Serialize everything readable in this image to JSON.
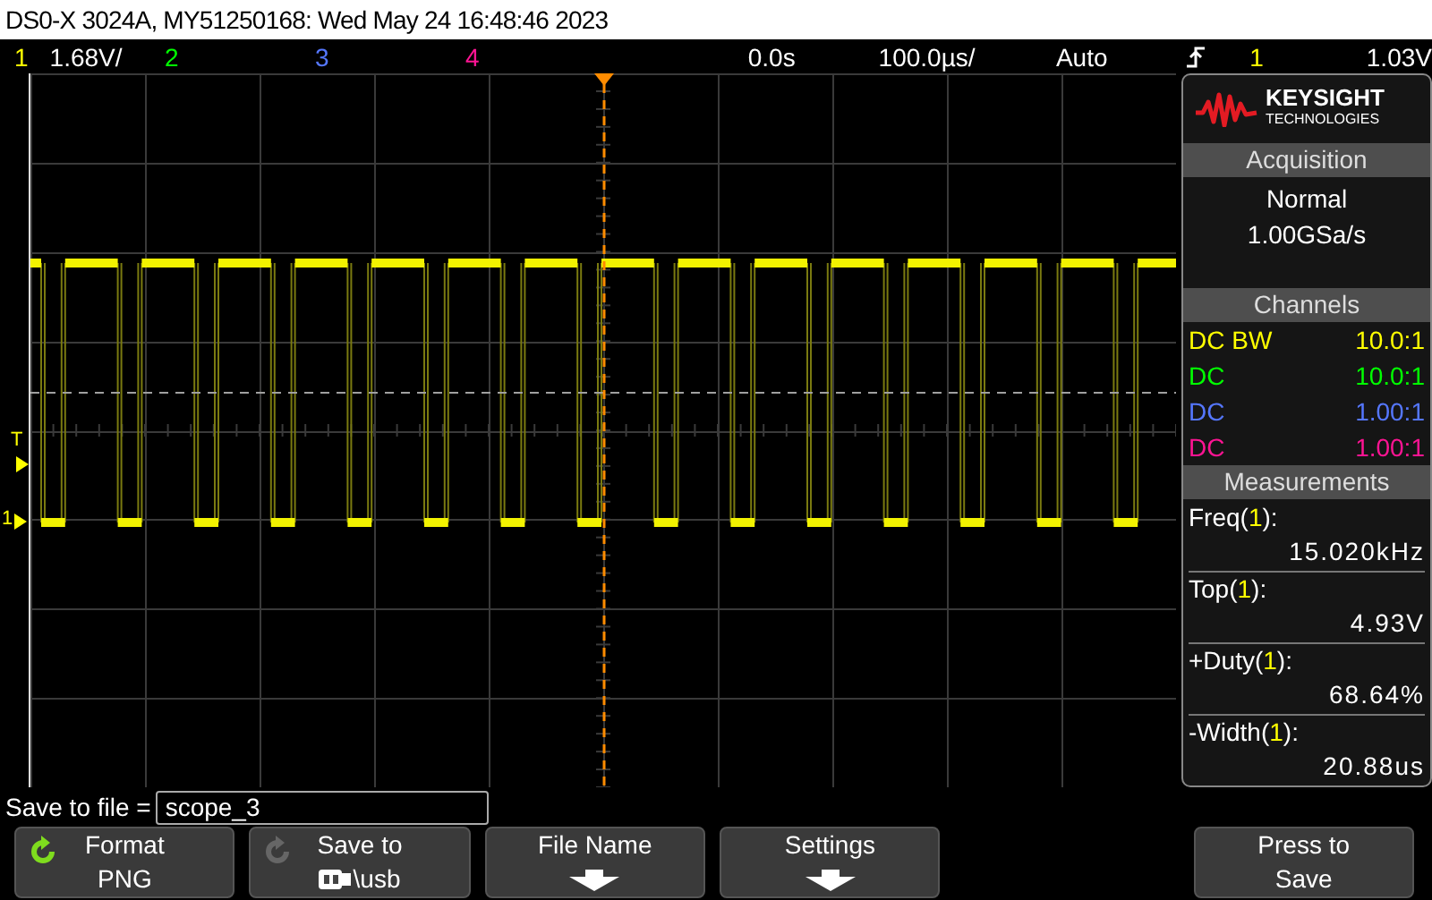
{
  "title_bar": {
    "text": "DS0-X 3024A, MY51250168: Wed May 24 16:48:46 2023"
  },
  "status_bar": {
    "channels": [
      {
        "label": "1",
        "scale": "1.68V/",
        "color": "#ffff00"
      },
      {
        "label": "2",
        "color": "#00ff00"
      },
      {
        "label": "3",
        "color": "#5577ff"
      },
      {
        "label": "4",
        "color": "#ff1493"
      }
    ],
    "delay": "0.0s",
    "timebase": "100.0µs/",
    "mode": "Auto",
    "trigger_source": "1",
    "trigger_level": "1.03V"
  },
  "graticule": {
    "trigger_marker": "T",
    "ground_marker": "1"
  },
  "panel": {
    "logo": {
      "name": "KEYSIGHT",
      "sub": "TECHNOLOGIES"
    },
    "acquisition": {
      "title": "Acquisition",
      "mode": "Normal",
      "rate": "1.00GSa/s"
    },
    "channels": {
      "title": "Channels",
      "rows": [
        {
          "coupling": "DC BW",
          "probe": "10.0:1",
          "color": "#ffff00"
        },
        {
          "coupling": "DC",
          "probe": "10.0:1",
          "color": "#00ff00"
        },
        {
          "coupling": "DC",
          "probe": "1.00:1",
          "color": "#5577ff"
        },
        {
          "coupling": "DC",
          "probe": "1.00:1",
          "color": "#ff1493"
        }
      ]
    },
    "measurements": {
      "title": "Measurements",
      "rows": [
        {
          "before": "Freq(",
          "source": "1",
          "after": "):",
          "value": "15.020kHz"
        },
        {
          "before": "Top(",
          "source": "1",
          "after": "):",
          "value": "4.93V"
        },
        {
          "before": "+Duty(",
          "source": "1",
          "after": "):",
          "value": "68.64%"
        },
        {
          "before": "-Width(",
          "source": "1",
          "after": "):",
          "value": "20.88us"
        }
      ]
    }
  },
  "save_row": {
    "label": "Save to file =",
    "value": "scope_3"
  },
  "softkeys": [
    {
      "kind": "cycle",
      "active": true,
      "title": "Format",
      "value": "PNG"
    },
    {
      "kind": "cycle",
      "active": false,
      "device_icon": true,
      "title": "Save to",
      "value": "\\usb"
    },
    {
      "kind": "arrow",
      "title": "File Name"
    },
    {
      "kind": "arrow",
      "title": "Settings"
    },
    {
      "kind": "empty"
    },
    {
      "kind": "plain",
      "title": "Press to",
      "value": "Save"
    }
  ]
}
